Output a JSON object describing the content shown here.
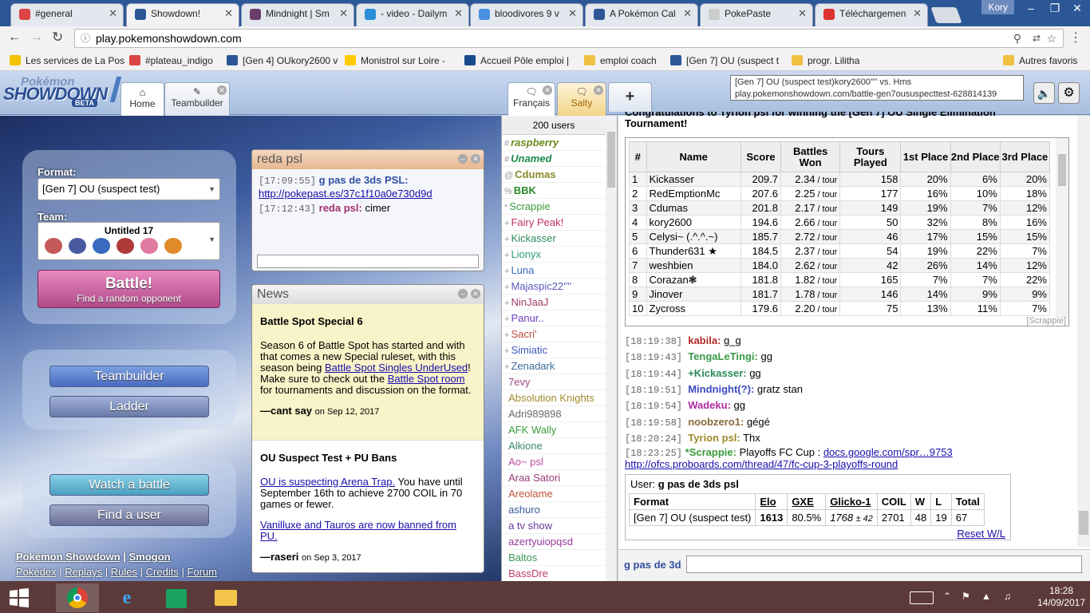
{
  "browser": {
    "tabs": [
      {
        "label": "#general",
        "color": "#d44",
        "active": false
      },
      {
        "label": "Showdown!",
        "color": "#2b5797",
        "active": true
      },
      {
        "label": "Mindnight | Sm",
        "color": "#6a3d6a",
        "active": false
      },
      {
        "label": "- video - Dailym",
        "color": "#2a8fd8",
        "active": false
      },
      {
        "label": "bloodivores 9 v",
        "color": "#4a90e2",
        "active": false
      },
      {
        "label": "A Pokémon Cal",
        "color": "#2b5797",
        "active": false
      },
      {
        "label": "PokePaste",
        "color": "#ccc",
        "active": false
      },
      {
        "label": "Téléchargemen",
        "color": "#d33",
        "active": false
      }
    ],
    "profile": "Kory",
    "url": "play.pokemonshowdown.com",
    "bookmarks": [
      {
        "label": "Les services de La Pos",
        "color": "#f4c200"
      },
      {
        "label": "#plateau_indigo",
        "color": "#d44"
      },
      {
        "label": "[Gen 4] OUkory2600 v",
        "color": "#2b5797"
      },
      {
        "label": "Monistrol sur Loire - ",
        "color": "#ffcc00"
      },
      {
        "label": "Accueil Pôle emploi |",
        "color": "#1a4a8a"
      },
      {
        "label": "emploi coach",
        "color": "#f0c040"
      },
      {
        "label": "[Gen 7] OU (suspect t",
        "color": "#2b5797"
      },
      {
        "label": "progr. Lilitha",
        "color": "#f0c040"
      },
      {
        "label": "Autres favoris",
        "color": "#f0c040"
      }
    ]
  },
  "header": {
    "logo_top": "Pokémon",
    "logo_main": "SHOWDOWN",
    "logo_beta": "BETA",
    "tabs": {
      "home": "Home",
      "teambuilder": "Teambuilder",
      "francais": "Français",
      "salty": "Salty",
      "plus": "+"
    },
    "url_tooltip": {
      "line1": "[Gen 7] OU (suspect test)kory2600'''' vs. Hms",
      "line2": "play.pokemonshowdown.com/battle-gen7oususpecttest-628814139"
    }
  },
  "main": {
    "format_label": "Format:",
    "format_value": "[Gen 7] OU (suspect test)",
    "team_label": "Team:",
    "team_value": "Untitled 17",
    "battle_label": "Battle!",
    "battle_sub": "Find a random opponent",
    "teambuilder": "Teambuilder",
    "ladder": "Ladder",
    "watch": "Watch a battle",
    "find_user": "Find a user",
    "footer_links1": [
      "Pokémon Showdown",
      "Smogon"
    ],
    "footer_links2": [
      "Pokédex",
      "Replays",
      "Rules",
      "Credits",
      "Forum"
    ]
  },
  "pm": {
    "title": "reda psl",
    "messages": [
      {
        "time": "[17:09:55]",
        "user": "g pas de 3ds PSL:",
        "text": "http://pokepast.es/37c1f10a0e730d9d",
        "color": "#3050a0"
      },
      {
        "time": "[17:12:43]",
        "user": "reda psl:",
        "text": "cimer",
        "color": "#a0306a"
      }
    ]
  },
  "news": {
    "title": "News",
    "items": [
      {
        "heading": "Battle Spot Special 6",
        "p1": "Season 6 of Battle Spot has started and with that comes a new Special ruleset, with this season being ",
        "link1": "Battle Spot Singles UnderUsed",
        "p2": "! Make sure to check out the ",
        "link2": "Battle Spot room",
        "p3": " for tournaments and discussion on the format.",
        "author": "—cant say",
        "date": "on Sep 12, 2017"
      },
      {
        "heading": "OU Suspect Test + PU Bans",
        "link1": "OU is suspecting Arena Trap.",
        "p1": " You have until September 16th to achieve 2700 COIL in 70 games or fewer.",
        "link2": "Vanilluxe and Tauros are now banned from PU.",
        "author": "—raseri",
        "date": "on Sep 3, 2017"
      }
    ]
  },
  "userlist": {
    "count": "200 users",
    "users": [
      {
        "g": "#",
        "name": "raspberry",
        "color": "#6a8a1a",
        "style": "bi"
      },
      {
        "g": "#",
        "name": "Unamed",
        "color": "#1a8a4a",
        "style": "bi"
      },
      {
        "g": "@",
        "name": "Cdumas",
        "color": "#8a8a2a",
        "style": "b"
      },
      {
        "g": "%",
        "name": "BBK",
        "color": "#2a8a2a",
        "style": "b"
      },
      {
        "g": "*",
        "name": "Scrappie",
        "color": "#3a9a3a",
        "style": ""
      },
      {
        "g": "+",
        "name": "Fairy Peak!",
        "color": "#c0306a",
        "style": ""
      },
      {
        "g": "+",
        "name": "Kickasser",
        "color": "#2a8a5a",
        "style": ""
      },
      {
        "g": "+",
        "name": "Lionyx",
        "color": "#2a9a7a",
        "style": ""
      },
      {
        "g": "+",
        "name": "Luna",
        "color": "#3a6ac0",
        "style": ""
      },
      {
        "g": "+",
        "name": "Majaspic22''''",
        "color": "#5a5ac0",
        "style": ""
      },
      {
        "g": "+",
        "name": "NinJaaJ",
        "color": "#a03a6a",
        "style": ""
      },
      {
        "g": "+",
        "name": "Panur..",
        "color": "#6a3ac0",
        "style": ""
      },
      {
        "g": "+",
        "name": "Sacri'",
        "color": "#c04a3a",
        "style": ""
      },
      {
        "g": "+",
        "name": "Simiatic",
        "color": "#3a5ac0",
        "style": ""
      },
      {
        "g": "+",
        "name": "Zenadark",
        "color": "#3a6a9a",
        "style": ""
      },
      {
        "g": "",
        "name": "7evy",
        "color": "#a04a8a",
        "style": ""
      },
      {
        "g": "",
        "name": "Absolution Knights",
        "color": "#a08a2a",
        "style": ""
      },
      {
        "g": "",
        "name": "Adri989898",
        "color": "#6a6a6a",
        "style": ""
      },
      {
        "g": "",
        "name": "AFK Wally",
        "color": "#3a9a3a",
        "style": ""
      },
      {
        "g": "",
        "name": "Alkione",
        "color": "#3a8a6a",
        "style": ""
      },
      {
        "g": "",
        "name": "Ao~ psl",
        "color": "#c04aa0",
        "style": ""
      },
      {
        "g": "",
        "name": "Araa Satori",
        "color": "#9a3a7a",
        "style": ""
      },
      {
        "g": "",
        "name": "Areolame",
        "color": "#c0503a",
        "style": ""
      },
      {
        "g": "",
        "name": "ashuro",
        "color": "#3a5aa0",
        "style": ""
      },
      {
        "g": "",
        "name": "a tv show",
        "color": "#6a3a9a",
        "style": ""
      },
      {
        "g": "",
        "name": "azertyuiopqsd",
        "color": "#9a3a9a",
        "style": ""
      },
      {
        "g": "",
        "name": "Baltos",
        "color": "#3a9a5a",
        "style": ""
      },
      {
        "g": "",
        "name": "BassDre",
        "color": "#c03a6a",
        "style": ""
      }
    ]
  },
  "chat": {
    "announce": "Congratulations to Tyrion psl for winning the [Gen 7] OU Single Elimination Tournament!",
    "tour_headers": [
      "#",
      "Name",
      "Score",
      "Battles Won",
      "Tours Played",
      "1st Place",
      "2nd Place",
      "3rd Place"
    ],
    "tour_rows": [
      [
        "1",
        "Kickasser",
        "209.7",
        "2.34",
        "158",
        "20%",
        "6%",
        "20%"
      ],
      [
        "2",
        "RedEmptionMc",
        "207.6",
        "2.25",
        "177",
        "16%",
        "10%",
        "18%"
      ],
      [
        "3",
        "Cdumas",
        "201.8",
        "2.17",
        "149",
        "19%",
        "7%",
        "12%"
      ],
      [
        "4",
        "kory2600",
        "194.6",
        "2.66",
        "50",
        "32%",
        "8%",
        "16%"
      ],
      [
        "5",
        "Celysi~ (.^.^.~)",
        "185.7",
        "2.72",
        "46",
        "17%",
        "15%",
        "15%"
      ],
      [
        "6",
        "Thunder631 ★",
        "184.5",
        "2.37",
        "54",
        "19%",
        "22%",
        "7%"
      ],
      [
        "7",
        "weshbien",
        "184.0",
        "2.62",
        "42",
        "26%",
        "14%",
        "12%"
      ],
      [
        "8",
        "Corazan❃",
        "181.8",
        "1.82",
        "165",
        "7%",
        "7%",
        "22%"
      ],
      [
        "9",
        "Jinover",
        "181.7",
        "1.78",
        "146",
        "14%",
        "9%",
        "9%"
      ],
      [
        "10",
        "Zycross",
        "179.6",
        "2.20",
        "75",
        "13%",
        "11%",
        "7%"
      ]
    ],
    "tour_unit": "/ tour",
    "tour_by": "[Scrappie]",
    "lines": [
      {
        "time": "[18:19:38]",
        "user": "kabila:",
        "text": "g_g",
        "color": "#b02a2a"
      },
      {
        "time": "[18:19:43]",
        "user": "TengaLeTingi:",
        "text": "gg",
        "color": "#3a9a4a"
      },
      {
        "time": "[18:19:44]",
        "user": "+Kickasser:",
        "text": "gg",
        "color": "#2a8a5a"
      },
      {
        "time": "[18:19:51]",
        "user": "Mindnight(?):",
        "text": "gratz stan",
        "color": "#3a4ac0"
      },
      {
        "time": "[18:19:54]",
        "user": "Wadeku:",
        "text": "gg",
        "color": "#b02aa0"
      },
      {
        "time": "[18:19:58]",
        "user": "noobzero1:",
        "text": "gégé",
        "color": "#8a6a3a"
      },
      {
        "time": "[18:20:24]",
        "user": "Tyrion psl:",
        "text": "Thx",
        "color": "#a08a2a"
      }
    ],
    "scrappie_line": {
      "time": "[18:23:25]",
      "user": "*Scrappie:",
      "text": "Playoffs FC Cup : ",
      "link1": "docs.google.com/spr…9753",
      "link2": "http://ofcs.proboards.com/thread/47/fc-cup-3-playoffs-round",
      "color": "#3a9a3a"
    },
    "userstats": {
      "label": "User:",
      "user": "g pas de 3ds psl",
      "headers": [
        "Format",
        "Elo",
        "GXE",
        "Glicko-1",
        "COIL",
        "W",
        "L",
        "Total"
      ],
      "row": [
        "[Gen 7] OU (suspect test)",
        "1613",
        "80.5%",
        "1768",
        "± 42",
        "2701",
        "48",
        "19",
        "67"
      ],
      "reset": "Reset W/L"
    },
    "input_user": "g pas de 3d"
  },
  "taskbar": {
    "time": "18:28",
    "date": "14/09/2017"
  }
}
